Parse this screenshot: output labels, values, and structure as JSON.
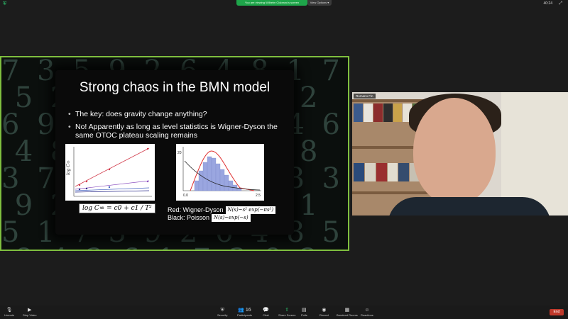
{
  "top_bar": {
    "share_banner": "You are viewing Wilhelm Ciuleanu's screen",
    "view_options": "View Options ▾",
    "clock": "40:24"
  },
  "slide": {
    "title": "Strong chaos in the BMN model",
    "bullets": [
      "The key: does gravity change anything?",
      "No! Apparently as long as level statistics is Wigner-Dyson the same OTOC plateau scaling remains"
    ],
    "formula_left": "log C∞ = c0 + c1 / T²",
    "caption_red_label": "Red: Wigner-Dyson",
    "caption_red_formula": "N(s)~s² exp(−πs²)",
    "caption_black_label": "Black: Poisson",
    "caption_black_formula": "N(s)~exp(−s)"
  },
  "participant": {
    "name": "Romano Fin"
  },
  "toolbar": {
    "items": [
      {
        "label": "Unmute",
        "icon": "microphone-muted-icon"
      },
      {
        "label": "Stop Video",
        "icon": "video-camera-icon"
      },
      {
        "label": "Security",
        "icon": "shield-icon"
      },
      {
        "label": "Participants",
        "icon": "people-icon",
        "count": "16"
      },
      {
        "label": "Chat",
        "icon": "chat-icon"
      },
      {
        "label": "Share Screen",
        "icon": "share-screen-icon"
      },
      {
        "label": "Polls",
        "icon": "polls-icon"
      },
      {
        "label": "Record",
        "icon": "record-icon"
      },
      {
        "label": "Breakout Rooms",
        "icon": "breakout-icon"
      },
      {
        "label": "Reactions",
        "icon": "smile-icon"
      }
    ],
    "end_label": "End"
  },
  "colors": {
    "share_border": "#7fbf3f",
    "banner_green": "#1ea54a",
    "end_red": "#c0392b"
  }
}
